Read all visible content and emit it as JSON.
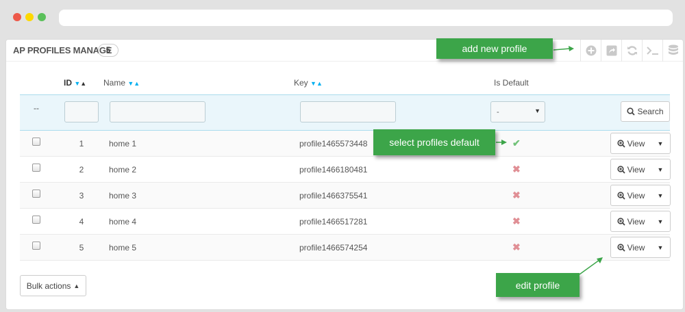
{
  "browser": {
    "address_value": ""
  },
  "panel": {
    "title": "AP PROFILES MANAGE",
    "count": "5",
    "toolbar": [
      {
        "name": "add-icon",
        "glyph": "⊕"
      },
      {
        "name": "export-icon",
        "glyph": "⬈"
      },
      {
        "name": "refresh-icon",
        "glyph": "⟳"
      },
      {
        "name": "sql-query-icon",
        "glyph": ">_"
      },
      {
        "name": "database-icon",
        "glyph": "≋"
      }
    ]
  },
  "table": {
    "headers": {
      "id": "ID",
      "name": "Name",
      "key": "Key",
      "is_default": "Is Default"
    },
    "filters": {
      "dash": "--",
      "select_value": "-",
      "search_label": "Search"
    },
    "rows": [
      {
        "id": "1",
        "name": "home 1",
        "key": "profile1465573448",
        "is_default": true
      },
      {
        "id": "2",
        "name": "home 2",
        "key": "profile1466180481",
        "is_default": false
      },
      {
        "id": "3",
        "name": "home 3",
        "key": "profile1466375541",
        "is_default": false
      },
      {
        "id": "4",
        "name": "home 4",
        "key": "profile1466517281",
        "is_default": false
      },
      {
        "id": "5",
        "name": "home 5",
        "key": "profile1466574254",
        "is_default": false
      }
    ],
    "view_label": "View",
    "bulk_label": "Bulk actions"
  },
  "callouts": {
    "add_new": "add new profile",
    "select_default": "select profiles default",
    "edit": "edit profile"
  },
  "colors": {
    "accent_blue": "#00aff0",
    "callout_green": "#3ca549",
    "check_green": "#72c279",
    "cross_red": "#e08f95"
  }
}
